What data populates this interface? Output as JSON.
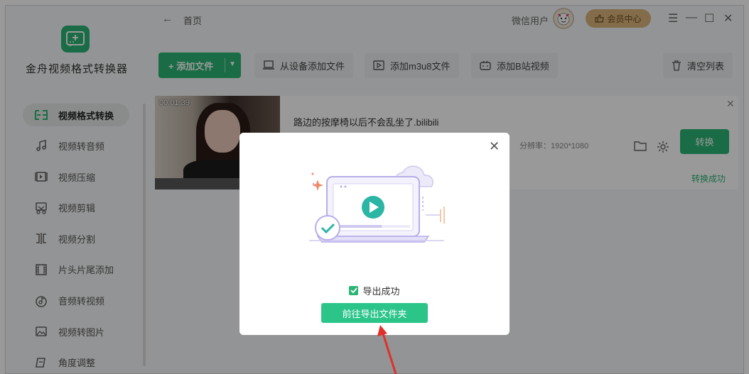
{
  "app": {
    "name": "金舟视频格式转换器"
  },
  "topbar": {
    "back_glyph": "←",
    "breadcrumb": "首页",
    "user_name": "微信用户",
    "vip_label": "会员中心",
    "menu_glyph": "☰",
    "min_glyph": "—",
    "max_glyph": "☐",
    "close_glyph": "✕"
  },
  "sidebar": {
    "items": [
      {
        "label": "视频格式转换",
        "icon": "format-convert-icon"
      },
      {
        "label": "视频转音频",
        "icon": "music-note-icon"
      },
      {
        "label": "视频压缩",
        "icon": "compress-icon"
      },
      {
        "label": "视频剪辑",
        "icon": "scissors-icon"
      },
      {
        "label": "视频分割",
        "icon": "split-icon"
      },
      {
        "label": "片头片尾添加",
        "icon": "film-icon"
      },
      {
        "label": "音频转视频",
        "icon": "audio-icon"
      },
      {
        "label": "视频转图片",
        "icon": "image-icon"
      },
      {
        "label": "角度调整",
        "icon": "rotate-icon"
      }
    ]
  },
  "toolbar": {
    "add_file": "+ 添加文件",
    "add_device": "从设备添加文件",
    "add_m3u8": "添加m3u8文件",
    "add_bilibili": "添加B站视频",
    "clear_list": "清空列表"
  },
  "file": {
    "duration": "00:01:39",
    "name": "路边的按摩椅以后不会乱坐了.bilibili",
    "resolution": "分辨率：1920*1080",
    "convert_label": "转换",
    "status": "转换成功"
  },
  "modal": {
    "success_text": "导出成功",
    "open_folder_label": "前往导出文件夹"
  },
  "colors": {
    "accent": "#2bb574",
    "vip": "#d9b47c",
    "arrow": "#e0302a"
  }
}
